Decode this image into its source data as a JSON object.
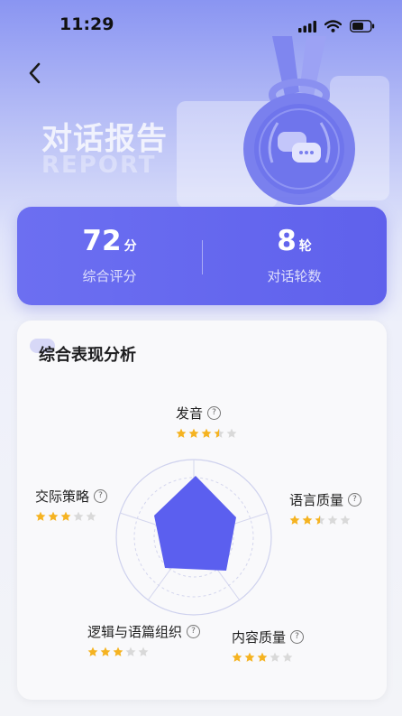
{
  "status_bar": {
    "time": "11:29"
  },
  "hero": {
    "title": "对话报告",
    "subtitle": "REPORT"
  },
  "summary": {
    "score_value": "72",
    "score_unit": "分",
    "score_label": "综合评分",
    "rounds_value": "8",
    "rounds_unit": "轮",
    "rounds_label": "对话轮数"
  },
  "analysis": {
    "title": "综合表现分析",
    "help_glyph": "?",
    "dimensions": [
      {
        "label": "发音",
        "stars": 3.5
      },
      {
        "label": "语言质量",
        "stars": 2.5
      },
      {
        "label": "内容质量",
        "stars": 3
      },
      {
        "label": "逻辑与语篇组织",
        "stars": 3
      },
      {
        "label": "交际策略",
        "stars": 3
      }
    ],
    "max_stars": 5
  },
  "colors": {
    "accent": "#6366f1",
    "star_on": "#f5b321",
    "star_off": "#d9d9d9",
    "radar_fill": "#5b5fef"
  },
  "icons": [
    "back-chevron-icon",
    "signal-icon",
    "wifi-icon",
    "battery-icon",
    "medal-chat-icon",
    "help-icon",
    "star-icon"
  ]
}
